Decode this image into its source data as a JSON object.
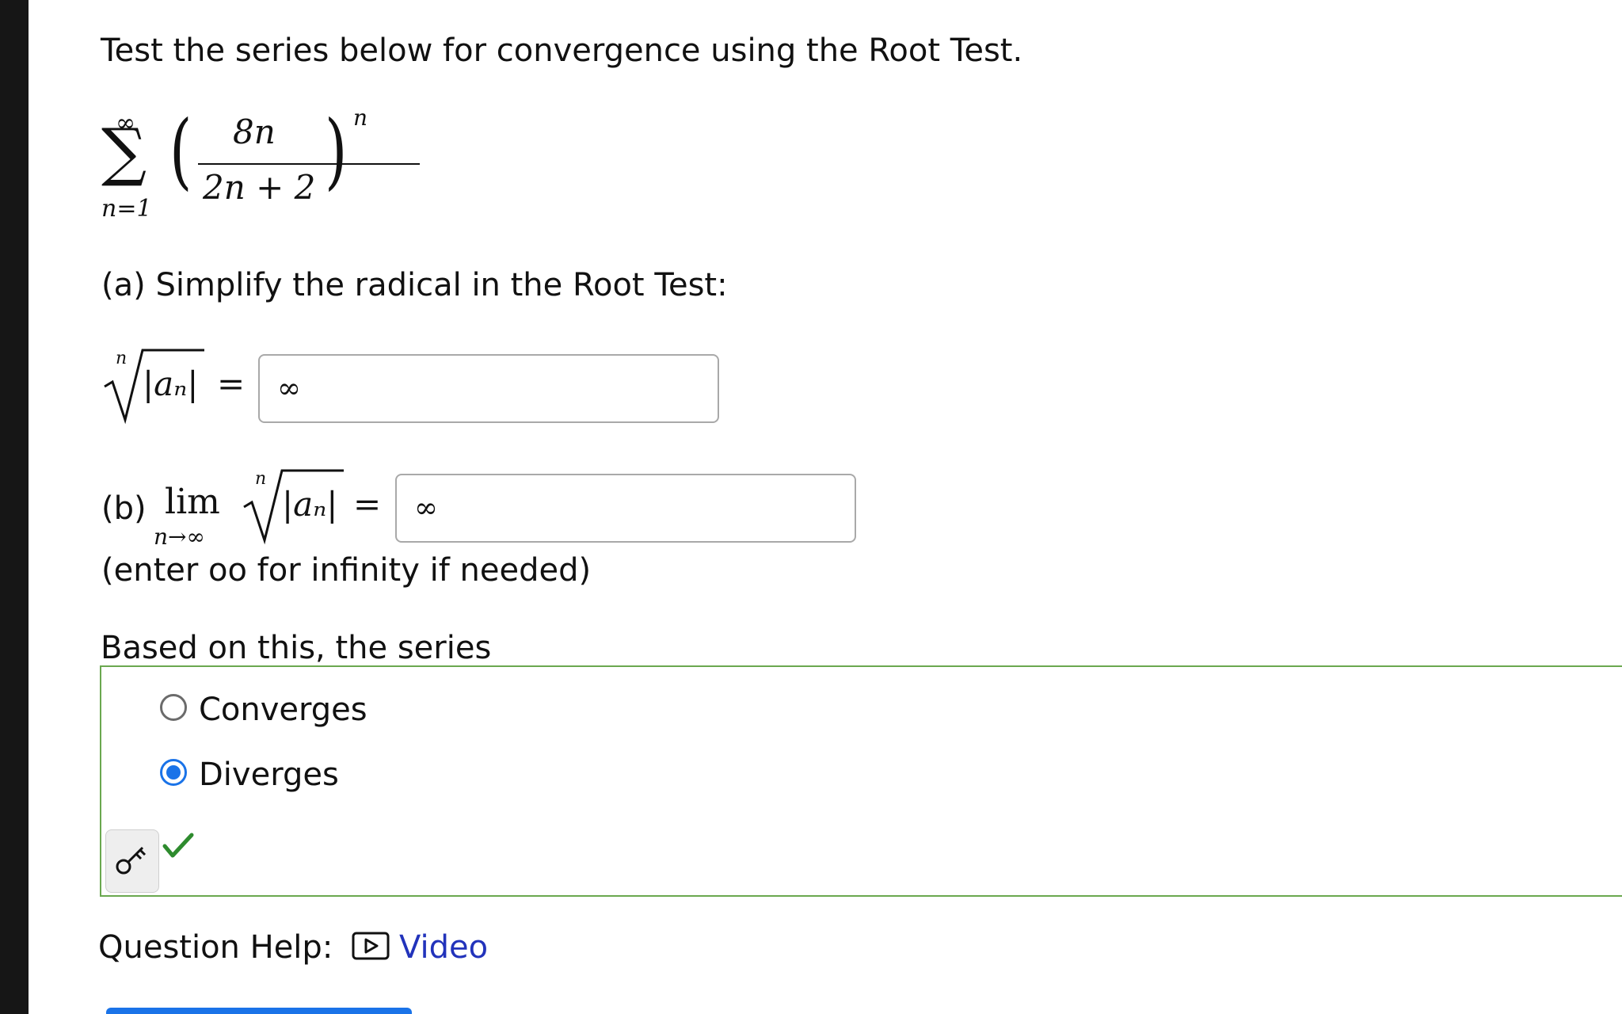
{
  "question": {
    "intro": "Test the series below for convergence using the Root Test.",
    "series": {
      "upper_limit": "∞",
      "lower_limit": "n=1",
      "numerator": "8n",
      "denominator": "2n + 2",
      "exponent": "n"
    }
  },
  "part_a": {
    "label": "(a) Simplify the radical in the Root Test:",
    "lhs_index": "n",
    "lhs_radicand": "|aₙ|",
    "equals": "=",
    "answer_value": "∞"
  },
  "part_b": {
    "label": "(b)",
    "lim_word": "lim",
    "lim_sub": "n→∞",
    "lhs_index": "n",
    "lhs_radicand": "|aₙ|",
    "equals": "=",
    "answer_value": "∞",
    "hint": "(enter oo for infinity if needed)"
  },
  "conclusion": {
    "prompt": "Based on this, the series",
    "options": [
      {
        "label": "Converges",
        "selected": false
      },
      {
        "label": "Diverges",
        "selected": true
      }
    ],
    "status_color": "#2e8b2e"
  },
  "help": {
    "label": "Question Help:",
    "video_label": "Video"
  },
  "colors": {
    "accent": "#1a73e8",
    "panel_border": "#6aa84f",
    "link": "#2233bb"
  }
}
